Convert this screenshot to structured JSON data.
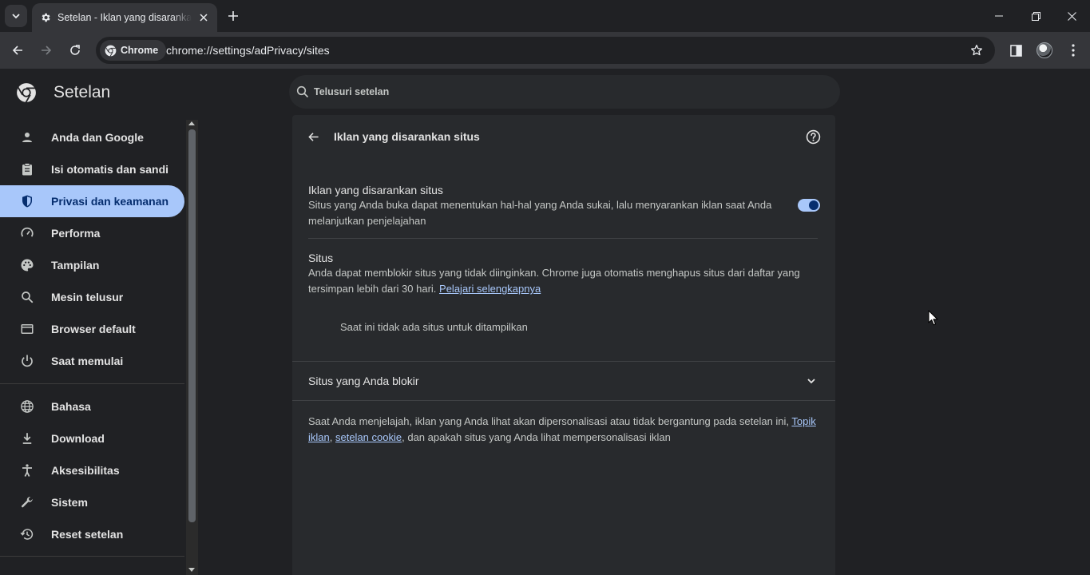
{
  "tab": {
    "title": "Setelan - Iklan yang disarankan situs"
  },
  "toolbar": {
    "chip_label": "Chrome",
    "url": "chrome://settings/adPrivacy/sites"
  },
  "header": {
    "app_title": "Setelan",
    "search_placeholder": "Telusuri setelan"
  },
  "sidebar": {
    "items": [
      {
        "label": "Anda dan Google",
        "icon": "person-icon"
      },
      {
        "label": "Isi otomatis dan sandi",
        "icon": "clipboard-icon"
      },
      {
        "label": "Privasi dan keamanan",
        "icon": "shield-icon",
        "active": true
      },
      {
        "label": "Performa",
        "icon": "speedometer-icon"
      },
      {
        "label": "Tampilan",
        "icon": "palette-icon"
      },
      {
        "label": "Mesin telusur",
        "icon": "search-icon"
      },
      {
        "label": "Browser default",
        "icon": "browser-icon"
      },
      {
        "label": "Saat memulai",
        "icon": "power-icon"
      },
      {
        "label": "Bahasa",
        "icon": "globe-icon"
      },
      {
        "label": "Download",
        "icon": "download-icon"
      },
      {
        "label": "Aksesibilitas",
        "icon": "accessibility-icon"
      },
      {
        "label": "Sistem",
        "icon": "wrench-icon"
      },
      {
        "label": "Reset setelan",
        "icon": "history-icon"
      }
    ]
  },
  "page": {
    "title": "Iklan yang disarankan situs",
    "toggle_row": {
      "title": "Iklan yang disarankan situs",
      "desc_line1": "Situs yang Anda buka dapat menentukan hal-hal yang Anda sukai, lalu menyarankan iklan saat Anda",
      "desc_line2": "melanjutkan penjelajahan",
      "enabled": true
    },
    "sites": {
      "title": "Situs",
      "desc_line1": "Anda dapat memblokir situs yang tidak diinginkan. Chrome juga otomatis menghapus situs dari daftar yang",
      "desc_line2_pre": "tersimpan lebih dari 30 hari. ",
      "learn_more": "Pelajari selengkapnya",
      "empty": "Saat ini tidak ada situs untuk ditampilkan"
    },
    "blocked": {
      "title": "Situs yang Anda blokir"
    },
    "footer": {
      "line1_pre": "Saat Anda menjelajah, iklan yang Anda lihat akan dipersonalisasi atau tidak bergantung pada setelan ini, ",
      "link_topics_1": "Topik",
      "link_topics_2": "iklan",
      "comma": ", ",
      "link_cookie": "setelan cookie",
      "line2_post": ", dan apakah situs yang Anda lihat mempersonalisasi iklan"
    }
  },
  "colors": {
    "accent": "#a8c7fa",
    "active_text": "#062e6f",
    "background": "#202124",
    "card": "#282a2d"
  }
}
